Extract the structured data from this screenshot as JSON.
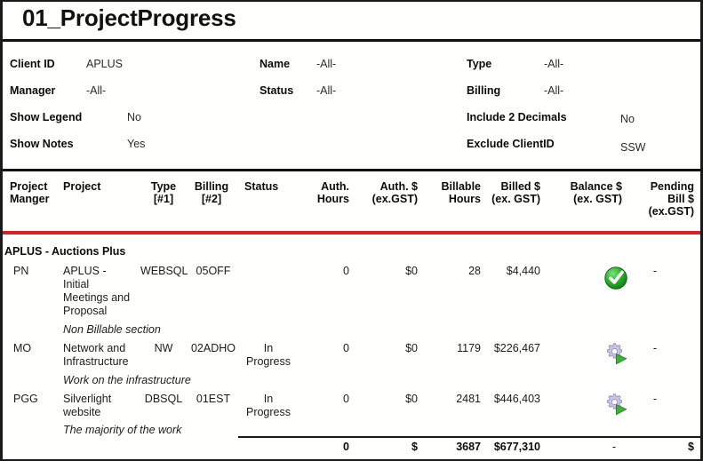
{
  "report": {
    "title": "01_ProjectProgress",
    "accent_red": "#d91f26",
    "rule_black": "#111111"
  },
  "parameters": [
    {
      "label": "Client ID",
      "value": "APLUS"
    },
    {
      "label": "Manager",
      "value": "-All-"
    },
    {
      "label": "Show Legend",
      "value": "No"
    },
    {
      "label": "Show Notes",
      "value": "Yes"
    },
    {
      "label": "Name",
      "value": "-All-"
    },
    {
      "label": "Status",
      "value": "-All-"
    },
    {
      "label": "Type",
      "value": "-All-"
    },
    {
      "label": "Billing",
      "value": "-All-"
    },
    {
      "label": "Include 2 Decimals",
      "value": "No"
    },
    {
      "label": "Exclude ClientID",
      "value": "SSW"
    }
  ],
  "columns": [
    {
      "line1": "Project",
      "line2": "Manger",
      "line3": ""
    },
    {
      "line1": "Project",
      "line2": "",
      "line3": ""
    },
    {
      "line1": "Type",
      "line2": "[#1]",
      "line3": ""
    },
    {
      "line1": "Billing",
      "line2": "[#2]",
      "line3": ""
    },
    {
      "line1": "Status",
      "line2": "",
      "line3": ""
    },
    {
      "line1": "Auth.",
      "line2": "Hours",
      "line3": ""
    },
    {
      "line1": "Auth. $",
      "line2": "(ex.GST)",
      "line3": ""
    },
    {
      "line1": "Billable",
      "line2": "Hours",
      "line3": ""
    },
    {
      "line1": "Billed $",
      "line2": "(ex. GST)",
      "line3": ""
    },
    {
      "line1": "Balance $",
      "line2": "(ex. GST)",
      "line3": ""
    },
    {
      "line1": "Pending",
      "line2": "Bill $",
      "line3": "(ex.GST)"
    }
  ],
  "group": {
    "label": "APLUS - Auctions Plus"
  },
  "rows": [
    {
      "manager": "PN",
      "project": "APLUS - Initial Meetings and Proposal",
      "type": "WEBSQL",
      "billing": "05OFF",
      "status": "",
      "auth_hours": "0",
      "auth_dollars": "$0",
      "billable_hours": "28",
      "billed_dollars": "$4,440",
      "balance_icon": "green-check-icon",
      "pending_bill": "-",
      "note": "Non Billable section"
    },
    {
      "manager": "MO",
      "project": "Network and Infrastructure",
      "type": "NW",
      "billing": "02ADHO",
      "status": "In Progress",
      "auth_hours": "0",
      "auth_dollars": "$0",
      "billable_hours": "1179",
      "billed_dollars": "$226,467",
      "balance_icon": "gear-play-icon",
      "pending_bill": "-",
      "note": "Work on the infrastructure"
    },
    {
      "manager": "PGG",
      "project": "Silverlight website",
      "type": "DBSQL",
      "billing": "01EST",
      "status": "In Progress",
      "auth_hours": "0",
      "auth_dollars": "$0",
      "billable_hours": "2481",
      "billed_dollars": "$446,403",
      "balance_icon": "gear-play-icon",
      "pending_bill": "-",
      "note": "The majority of the work"
    }
  ],
  "totals": {
    "auth_hours": "0",
    "auth_dollars": "$",
    "billable_hours": "3687",
    "billed_dollars": "$677,310",
    "balance": "-",
    "pending_bill": "$"
  }
}
